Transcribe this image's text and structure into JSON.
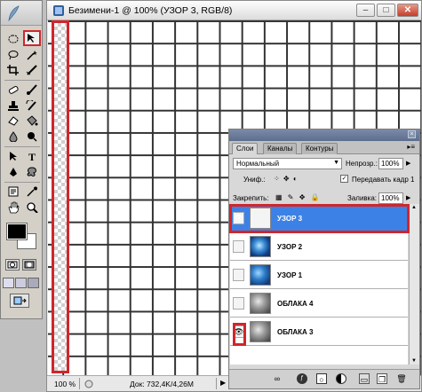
{
  "document": {
    "title": "Безимени-1 @ 100% (УЗОР 3, RGB/8)",
    "window_controls": {
      "minimize": "–",
      "maximize": "□",
      "close": "✕"
    },
    "status": {
      "zoom": "100 %",
      "doc_size": "Док: 732,4K/4,26M"
    }
  },
  "toolbox": {
    "tools": [
      "marquee-tool",
      "move-tool",
      "lasso-tool",
      "magic-wand-tool",
      "crop-tool",
      "slice-tool",
      "healing-brush-tool",
      "brush-tool",
      "clone-stamp-tool",
      "history-brush-tool",
      "eraser-tool",
      "paint-bucket-tool",
      "blur-tool",
      "dodge-tool",
      "path-selection-tool",
      "type-tool",
      "pen-tool",
      "custom-shape-tool",
      "notes-tool",
      "eyedropper-tool",
      "hand-tool",
      "zoom-tool"
    ],
    "foreground_color": "#000000",
    "background_color": "#ffffff"
  },
  "layers_panel": {
    "tabs": [
      "Слои",
      "Каналы",
      "Контуры"
    ],
    "menu_glyph": "▸≡",
    "blend_mode": "Нормальный",
    "opacity_label": "Непрозр.:",
    "opacity_value": "100%",
    "unify_label": "Униф.:",
    "propagate_label": "Передавать кадр 1",
    "propagate_checked": "✓",
    "lock_label": "Закрепить:",
    "fill_label": "Заливка:",
    "fill_value": "100%",
    "layers": [
      {
        "name": "УЗОР 3",
        "visible": "👁",
        "selected": true,
        "thumb": "plain"
      },
      {
        "name": "УЗОР 2",
        "visible": "",
        "selected": false,
        "thumb": "blue"
      },
      {
        "name": "УЗОР 1",
        "visible": "",
        "selected": false,
        "thumb": "blue2"
      },
      {
        "name": "ОБЛАКА 4",
        "visible": "",
        "selected": false,
        "thumb": "gray"
      },
      {
        "name": "ОБЛАКА 3",
        "visible": "👁",
        "selected": false,
        "thumb": "gray"
      }
    ],
    "bottom_icons": [
      "link-icon",
      "fx-icon",
      "mask-icon",
      "adjustment-icon",
      "group-icon",
      "new-layer-icon",
      "trash-icon"
    ]
  },
  "accent": {
    "highlight_red": "#d0262b",
    "selection_blue": "#3c82e6"
  }
}
